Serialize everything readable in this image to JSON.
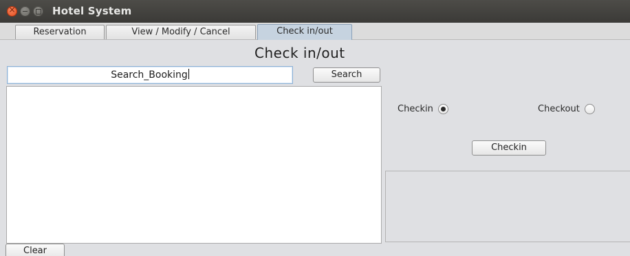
{
  "window": {
    "title": "Hotel System"
  },
  "tabs": [
    {
      "label": "Reservation",
      "active": false
    },
    {
      "label": "View / Modify / Cancel",
      "active": false
    },
    {
      "label": "Check in/out",
      "active": true
    }
  ],
  "main": {
    "heading": "Check in/out",
    "search": {
      "value": "Search_Booking",
      "button_label": "Search"
    },
    "radios": [
      {
        "label": "Checkin",
        "checked": true
      },
      {
        "label": "Checkout",
        "checked": false
      }
    ],
    "action_button_label": "Checkin",
    "clear_button_label": "Clear"
  },
  "colors": {
    "active_tab": "#c6d3e0",
    "titlebar": "#3b3a37",
    "close_button": "#e0491b"
  }
}
